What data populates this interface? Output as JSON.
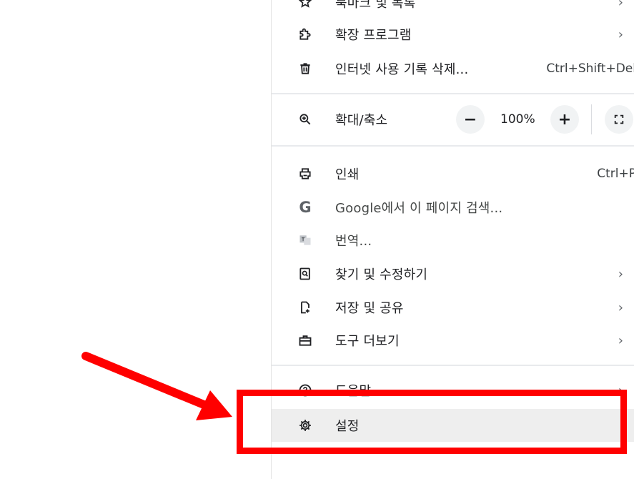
{
  "menu": {
    "items": [
      {
        "label": "북마크 및 목록",
        "chevron": "›"
      },
      {
        "label": "확장 프로그램",
        "chevron": "›"
      },
      {
        "label": "인터넷 사용 기록 삭제...",
        "shortcut": "Ctrl+Shift+Del"
      },
      {
        "label": "확대/축소",
        "zoom_value": "100%",
        "minus": "−",
        "plus": "+"
      },
      {
        "label": "인쇄",
        "shortcut": "Ctrl+P"
      },
      {
        "label": "Google에서 이 페이지 검색...",
        "icon_text": "G"
      },
      {
        "label": "번역..."
      },
      {
        "label": "찾기 및 수정하기",
        "chevron": "›"
      },
      {
        "label": "저장 및 공유",
        "chevron": "›"
      },
      {
        "label": "도구 더보기",
        "chevron": "›"
      },
      {
        "label": "도움말",
        "chevron": "›"
      },
      {
        "label": "설정"
      }
    ]
  },
  "icons": {
    "bookmark": "star-icon",
    "extensions": "puzzle-icon",
    "clear_history": "trash-icon",
    "zoom": "zoom-in-icon",
    "fullscreen": "fullscreen-icon",
    "print": "printer-icon",
    "google": "google-icon",
    "translate": "translate-icon",
    "find": "find-icon",
    "save_share": "save-share-icon",
    "more_tools": "toolbox-icon",
    "help": "help-icon",
    "settings": "gear-icon"
  },
  "annotation": {
    "highlight_color": "#ff0000"
  }
}
